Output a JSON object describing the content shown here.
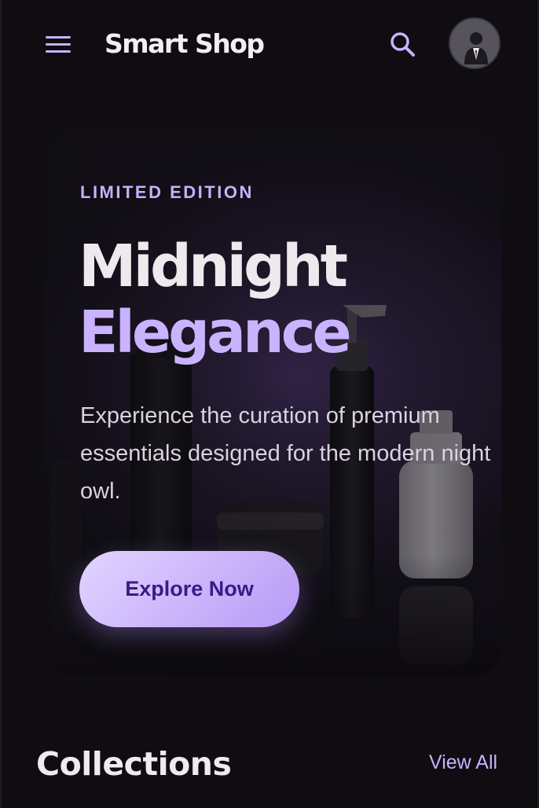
{
  "header": {
    "menu_icon": "hamburger-menu-icon",
    "brand": "Smart Shop",
    "search_icon": "search-icon",
    "avatar": "user-avatar"
  },
  "hero": {
    "eyebrow": "LIMITED EDITION",
    "title_line_1": "Midnight",
    "title_line_2": "Elegance",
    "description": "Experience the curation of premium essentials designed for the modern night owl.",
    "cta_label": "Explore Now"
  },
  "collections": {
    "title": "Collections",
    "view_all_label": "View All"
  },
  "colors": {
    "background": "#0f0d12",
    "accent": "#c6b1fb",
    "button_text": "#3b1a86"
  }
}
